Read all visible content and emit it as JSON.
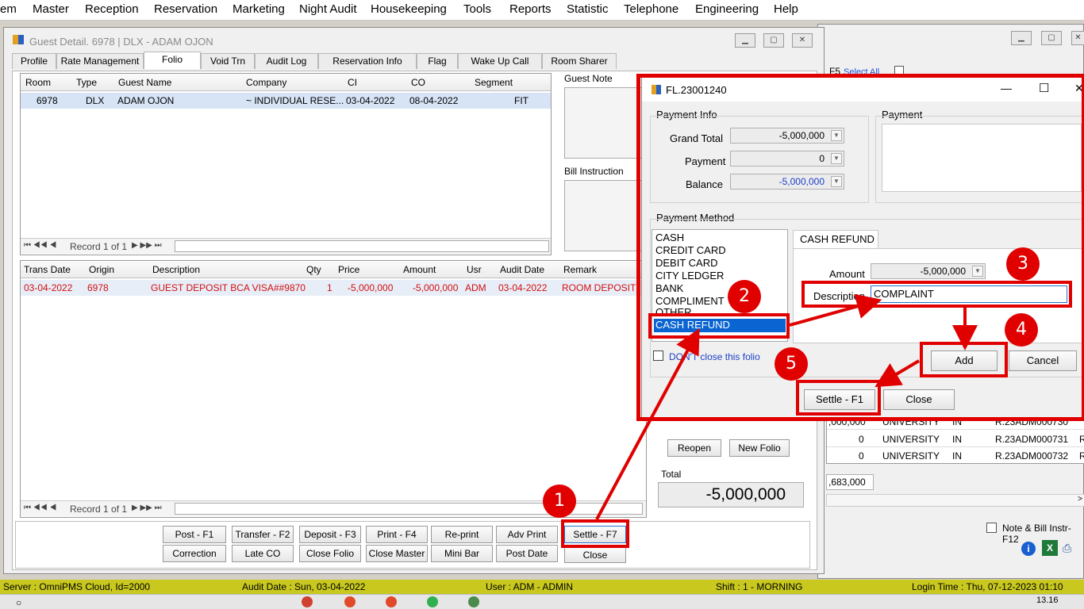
{
  "menu": [
    "em",
    "Master",
    "Reception",
    "Reservation",
    "Marketing",
    "Night Audit",
    "Housekeeping",
    "Tools",
    "Reports",
    "Statistic",
    "Telephone",
    "Engineering",
    "Help"
  ],
  "guest_window": {
    "title": "Guest Detail. 6978 | DLX - ADAM OJON",
    "tabs": [
      "Profile",
      "Rate Management",
      "Folio",
      "Void Trn",
      "Audit Log",
      "Reservation Info",
      "Flag",
      "Wake Up Call",
      "Room Sharer"
    ],
    "room_table": {
      "headers": [
        "Room",
        "Type",
        "Guest Name",
        "Company",
        "CI",
        "CO",
        "Segment"
      ],
      "rows": [
        [
          "6978",
          "DLX",
          "ADAM OJON",
          "~ INDIVIDUAL RESE...",
          "03-04-2022",
          "08-04-2022",
          "FIT"
        ]
      ]
    },
    "record_nav": "Record 1 of 1",
    "guest_note_label": "Guest Note",
    "bill_instruction_label": "Bill Instruction",
    "trans_table": {
      "headers": [
        "Trans Date",
        "Origin",
        "Description",
        "Qty",
        "Price",
        "Amount",
        "Usr",
        "Audit Date",
        "Remark"
      ],
      "rows": [
        [
          "03-04-2022",
          "6978",
          "GUEST DEPOSIT BCA VISA##9870",
          "1",
          "-5,000,000",
          "-5,000,000",
          "ADM",
          "03-04-2022",
          "ROOM DEPOSIT"
        ]
      ]
    },
    "record_nav2": "Record 1 of 1",
    "buttons_row1": [
      "Post - F1",
      "Transfer - F2",
      "Deposit - F3",
      "Print - F4",
      "Re-print",
      "Adv Print",
      "Settle - F7"
    ],
    "buttons_row2": [
      "Correction",
      "Late CO",
      "Close Folio",
      "Close Master",
      "Mini Bar",
      "Post Date",
      "Close"
    ],
    "reopen": "Reopen",
    "new_folio": "New Folio",
    "total_label": "Total",
    "total_value": "-5,000,000"
  },
  "back_window": {
    "f5_label": "F5",
    "select_all": "Select All",
    "rows": [
      {
        "num": "0",
        "company": "UNIVERSITY",
        "st": "IN",
        "ref": "R.23ADM000731",
        "ex": "R"
      },
      {
        "num": "0",
        "company": "UNIVERSITY",
        "st": "IN",
        "ref": "R.23ADM000732",
        "ex": "R"
      }
    ],
    "partial_row": {
      "num": ",000,000",
      "company": "UNIVERSITY",
      "st": "IN",
      "ref": "R.23ADM000730",
      "ex": "R"
    },
    "footer_value": ",683,000",
    "note_bill": "Note & Bill Instr-F12"
  },
  "payment_dialog": {
    "title": "FL.23001240",
    "payment_info_label": "Payment Info",
    "payment_label": "Payment",
    "grand_total_label": "Grand Total",
    "grand_total": "-5,000,000",
    "payment_field_label": "Payment",
    "payment_value": "0",
    "balance_label": "Balance",
    "balance_value": "-5,000,000",
    "payment_method_label": "Payment Method",
    "methods": [
      "CASH",
      "CREDIT CARD",
      "DEBIT CARD",
      "CITY LEDGER",
      "BANK",
      "COMPLIMENT",
      "OTHER",
      "CASH REFUND"
    ],
    "selected_method": "CASH REFUND",
    "tab_label": "CASH REFUND",
    "amount_label": "Amount",
    "amount_value": "-5,000,000",
    "description_label": "Description",
    "description_value": "COMPLAINT",
    "add": "Add",
    "cancel": "Cancel",
    "dont_close": "DON'T close this folio",
    "settle": "Settle - F1",
    "close": "Close"
  },
  "badges": [
    "1",
    "2",
    "3",
    "4",
    "5"
  ],
  "statusbar": {
    "server": "Server : OmniPMS Cloud, Id=2000",
    "audit": "Audit Date : Sun, 03-04-2022",
    "user": "User : ADM - ADMIN",
    "shift": "Shift : 1 - MORNING",
    "login": "Login Time : Thu, 07-12-2023 01:10"
  },
  "clock": "13.16",
  "colors": {
    "annotation": "#e00000",
    "selection": "#0a64d2",
    "status": "#c8c81e",
    "trans_text": "#d01010"
  }
}
